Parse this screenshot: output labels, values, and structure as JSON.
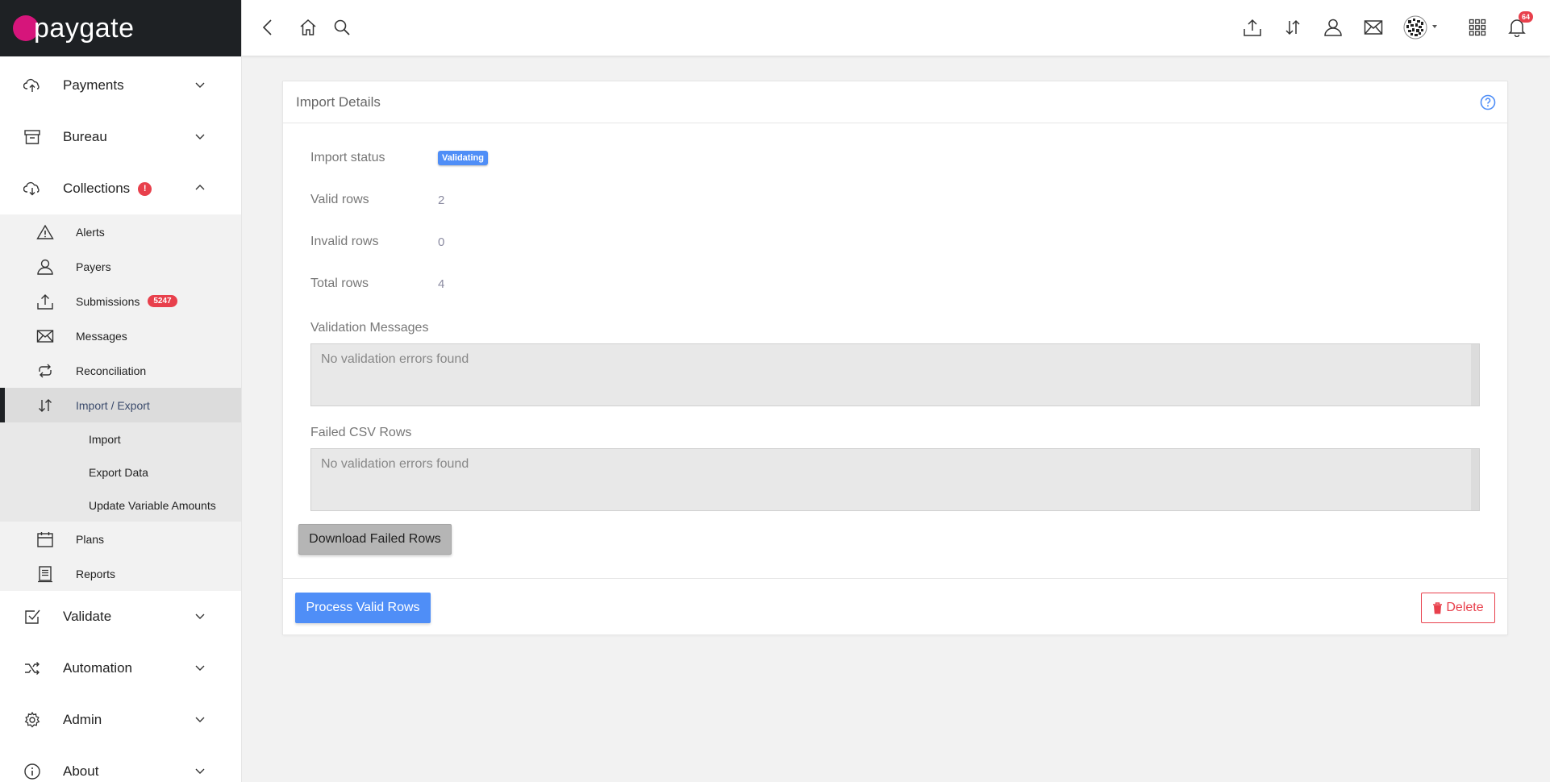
{
  "brand": {
    "logo_text": "paygate",
    "logo_color": "#d6157b"
  },
  "sidebar": {
    "top_items": [
      {
        "label": "Payments",
        "icon": "cloud-upload-icon"
      },
      {
        "label": "Bureau",
        "icon": "archive-icon"
      },
      {
        "label": "Collections",
        "icon": "cloud-download-icon",
        "alert_badge": "!"
      }
    ],
    "collections_items": [
      {
        "label": "Alerts",
        "icon": "warning-icon"
      },
      {
        "label": "Payers",
        "icon": "user-icon"
      },
      {
        "label": "Submissions",
        "icon": "upload-icon",
        "count": "5247"
      },
      {
        "label": "Messages",
        "icon": "mail-icon"
      },
      {
        "label": "Reconciliation",
        "icon": "refresh-icon"
      },
      {
        "label": "Import / Export",
        "icon": "import-export-icon"
      }
    ],
    "import_export_items": [
      {
        "label": "Import"
      },
      {
        "label": "Export Data"
      },
      {
        "label": "Update Variable Amounts"
      }
    ],
    "collections_items_after": [
      {
        "label": "Plans",
        "icon": "calendar-icon"
      },
      {
        "label": "Reports",
        "icon": "report-icon"
      }
    ],
    "bottom_items": [
      {
        "label": "Validate",
        "icon": "checkbox-icon"
      },
      {
        "label": "Automation",
        "icon": "shuffle-icon"
      },
      {
        "label": "Admin",
        "icon": "gear-icon"
      },
      {
        "label": "About",
        "icon": "info-icon"
      }
    ]
  },
  "topbar": {
    "notifications_count": "64",
    "icons": [
      "back-icon",
      "home-icon",
      "search-icon",
      "upload-icon",
      "transfer-icon",
      "user-icon",
      "mail-icon",
      "avatar",
      "apps-grid-icon",
      "bell-icon"
    ]
  },
  "card": {
    "title": "Import Details",
    "fields": [
      {
        "label": "Import status",
        "value": "Validating",
        "type": "badge"
      },
      {
        "label": "Valid rows",
        "value": "2"
      },
      {
        "label": "Invalid rows",
        "value": "0"
      },
      {
        "label": "Total rows",
        "value": "4"
      }
    ],
    "validation_messages": {
      "label": "Validation Messages",
      "value": "No validation errors found"
    },
    "failed_csv_rows": {
      "label": "Failed CSV Rows",
      "value": "No validation errors found"
    },
    "download_button": "Download Failed Rows",
    "process_button": "Process Valid Rows",
    "delete_button": "Delete"
  },
  "colors": {
    "primary": "#4f8ef7",
    "danger": "#e8404c",
    "sidebar_header": "#1e2124"
  }
}
